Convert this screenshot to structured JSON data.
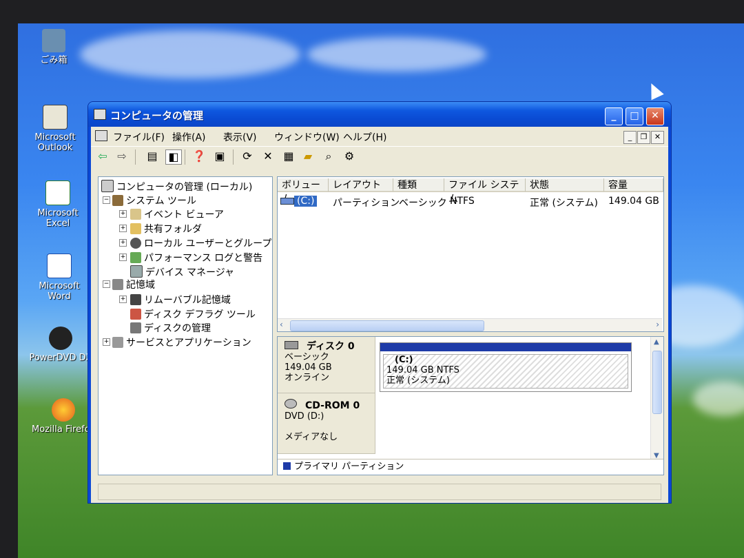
{
  "desktop": {
    "icons": [
      {
        "label": "ごみ箱"
      },
      {
        "label": "Microsoft Outlook"
      },
      {
        "label": "Microsoft Excel"
      },
      {
        "label": "Microsoft Word"
      },
      {
        "label": "PowerDVD DX"
      },
      {
        "label": "Mozilla Firefox"
      }
    ]
  },
  "window": {
    "title": "コンピュータの管理",
    "controls": {
      "minimize": "_",
      "maximize": "□",
      "close": "✕"
    }
  },
  "menubar": {
    "items": [
      "ファイル(F)",
      "操作(A)",
      "表示(V)",
      "ウィンドウ(W)",
      "ヘルプ(H)"
    ]
  },
  "toolbar": {
    "icons": [
      "back-arrow-icon",
      "forward-arrow-icon",
      "up-folder-icon",
      "show-hide-tree-icon",
      "properties-help-icon",
      "export-list-icon",
      "refresh-icon",
      "delete-icon",
      "properties-icon",
      "open-icon",
      "search-icon",
      "settings-icon"
    ]
  },
  "tree": {
    "root": "コンピュータの管理 (ローカル)",
    "system_tools": "システム ツール",
    "event_viewer": "イベント ビューア",
    "shared_folders": "共有フォルダ",
    "local_users": "ローカル ユーザーとグループ",
    "performance": "パフォーマンス ログと警告",
    "device_manager": "デバイス マネージャ",
    "storage": "記憶域",
    "removable": "リムーバブル記憶域",
    "defrag": "ディスク デフラグ ツール",
    "disk_mgmt": "ディスクの管理",
    "services": "サービスとアプリケーション"
  },
  "volume_list": {
    "columns": [
      "ボリューム",
      "レイアウト",
      "種類",
      "ファイル システム",
      "状態",
      "容量"
    ],
    "rows": [
      {
        "volume": "(C:)",
        "layout": "パーティション",
        "type": "ベーシック",
        "fs": "NTFS",
        "status": "正常 (システム)",
        "capacity": "149.04 GB"
      }
    ]
  },
  "disks": {
    "disk0": {
      "name": "ディスク 0",
      "type": "ベーシック",
      "size": "149.04 GB",
      "state": "オンライン",
      "partition": {
        "label": "(C:)",
        "size_fs": "149.04 GB NTFS",
        "status": "正常 (システム)"
      }
    },
    "cdrom0": {
      "name": "CD-ROM 0",
      "drive": "DVD (D:)",
      "media": "メディアなし"
    },
    "legend": "プライマリ パーティション",
    "colors": {
      "primary_partition": "#1e3ba8"
    }
  }
}
